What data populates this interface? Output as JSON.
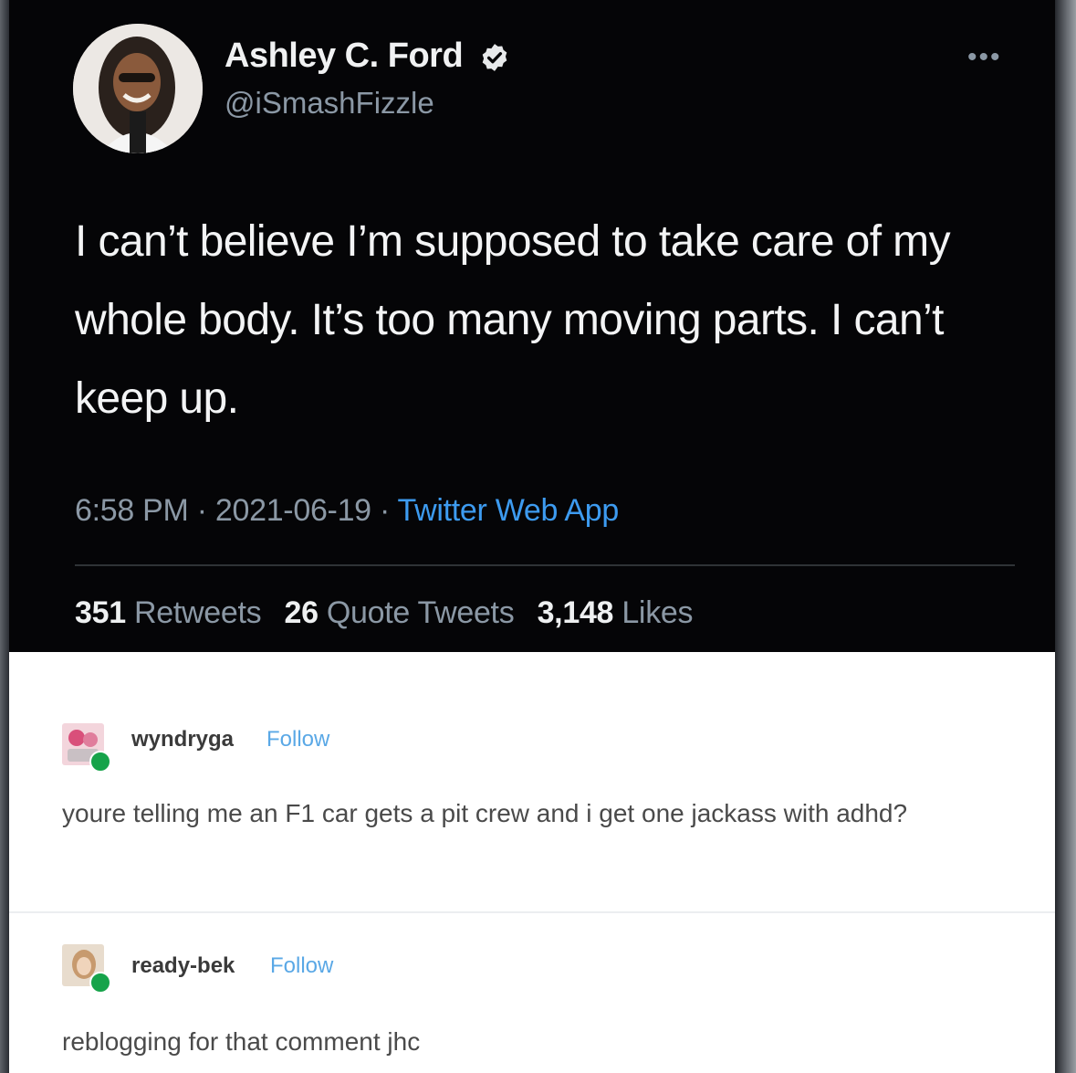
{
  "tweet": {
    "name": "Ashley C. Ford",
    "handle": "@iSmashFizzle",
    "more_icon": "ellipsis-icon",
    "verified_icon": "verified-badge-icon",
    "text": "I can’t believe I’m supposed to take care of my whole body. It’s too many moving parts. I can’t keep up.",
    "time": "6:58 PM",
    "date": "2021-06-19",
    "separator": "·",
    "source": "Twitter Web App",
    "stats": {
      "retweets_count": "351",
      "retweets_label": "Retweets",
      "quotes_count": "26",
      "quotes_label": "Quote Tweets",
      "likes_count": "3,148",
      "likes_label": "Likes"
    },
    "colors": {
      "background": "#050507",
      "link": "#3d9bf0",
      "muted": "#8b98a5"
    }
  },
  "reblogs": [
    {
      "username": "wyndryga",
      "follow_label": "Follow",
      "text": "youre telling me an F1 car gets a pit crew and i get one jackass with adhd?"
    },
    {
      "username": "ready-bek",
      "follow_label": "Follow",
      "text": "reblogging for that comment jhc"
    }
  ],
  "colors": {
    "follow": "#5aa8e6",
    "badge": "#16a34a"
  }
}
